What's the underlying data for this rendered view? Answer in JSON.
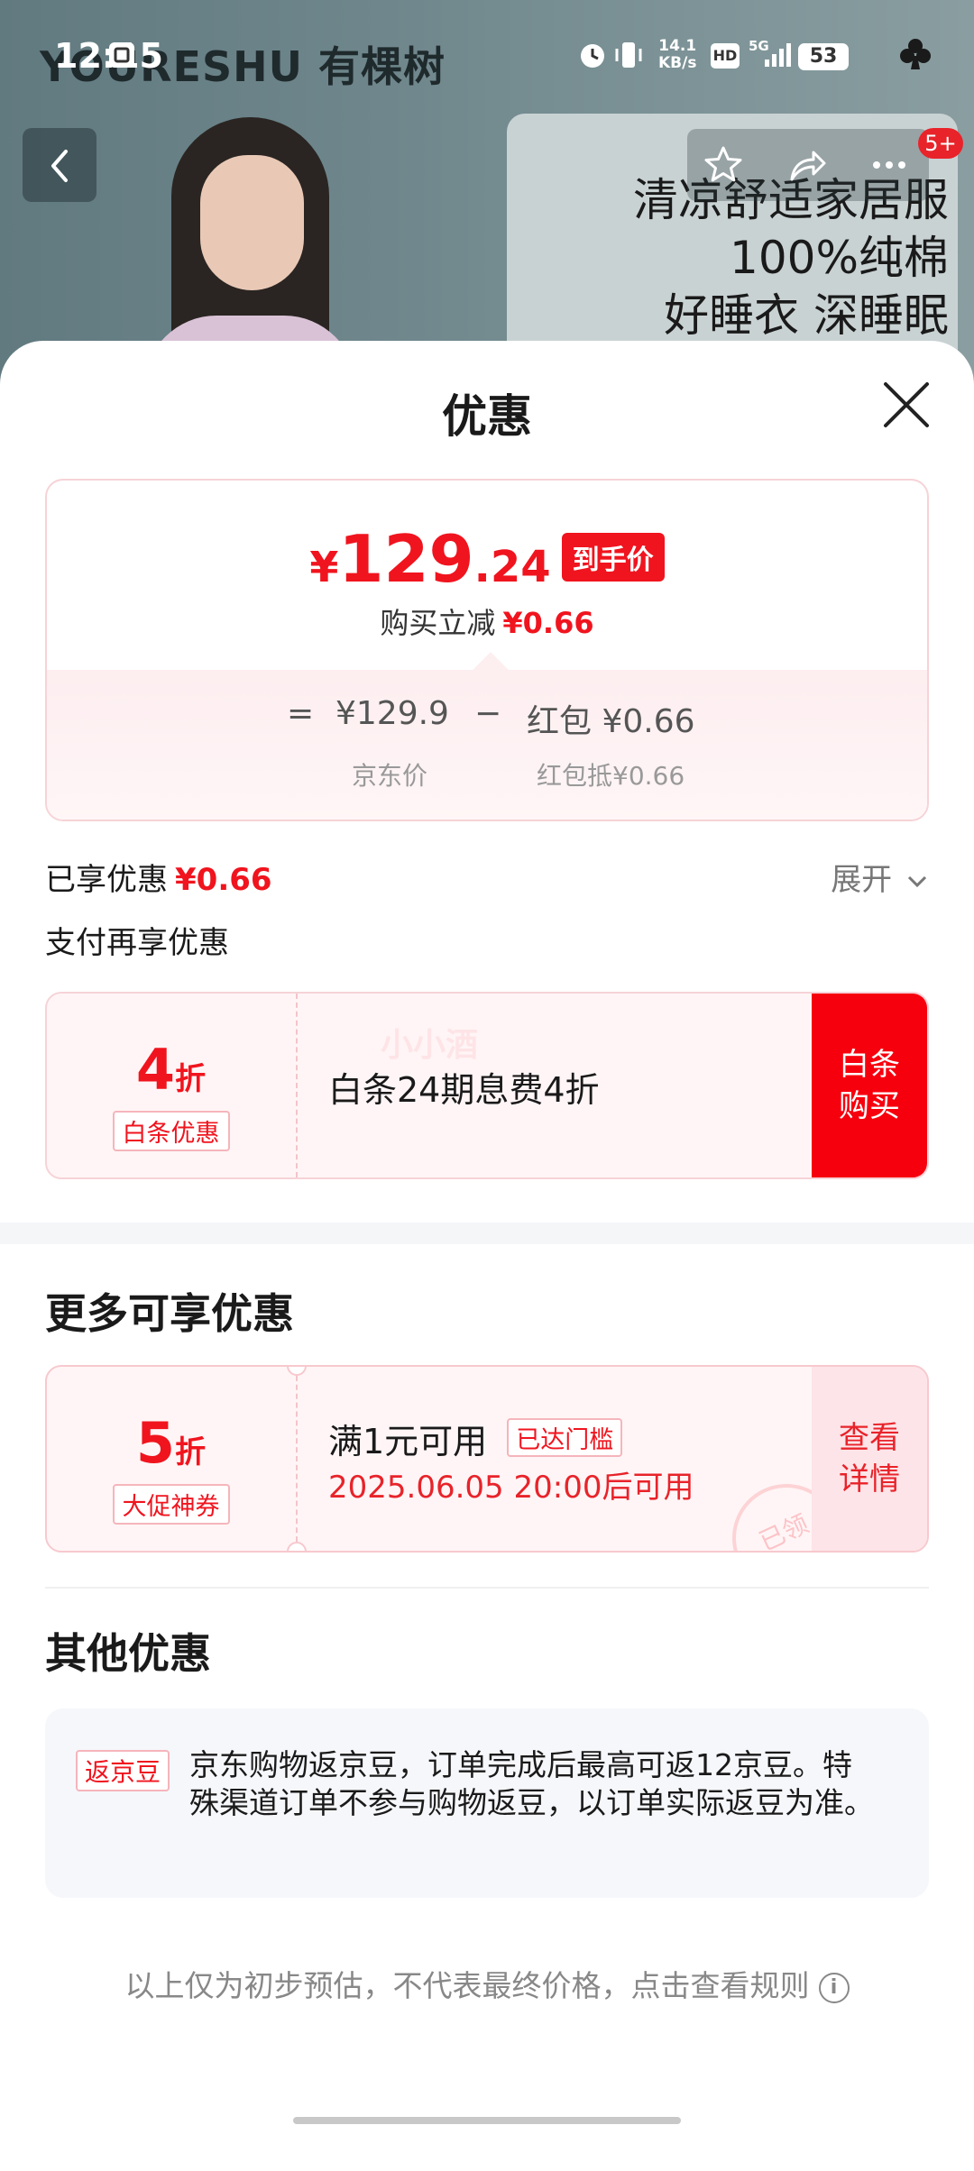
{
  "status_bar": {
    "time": "12:15",
    "net_speed_value": "14.1",
    "net_speed_unit": "KB/s",
    "hd_label": "HD",
    "network_label": "5G",
    "battery_level": "53"
  },
  "background": {
    "brand": "YOURESHU 有棵树",
    "slogan_lines": [
      "清凉舒适家居服",
      "100%纯棉",
      "好睡衣 深睡眠"
    ],
    "message_badge": "5+"
  },
  "sheet": {
    "title": "优惠",
    "price": {
      "currency": "¥",
      "integer": "129",
      "decimal": ".24",
      "tag": "到手价",
      "instant_reduce_label": "购买立减",
      "instant_reduce_value": "¥0.66",
      "formula_eq": "=",
      "jd_price": "¥129.9",
      "minus": "−",
      "redpacket": "红包 ¥0.66",
      "jd_price_caption": "京东价",
      "redpacket_caption": "红包抵¥0.66"
    },
    "enjoyed_label": "已享优惠",
    "enjoyed_value": "¥0.66",
    "expand_label": "展开",
    "pay_more_label": "支付再享优惠",
    "baitiao": {
      "discount_num": "4",
      "discount_unit": "折",
      "kind": "白条优惠",
      "text": "白条24期息费4折",
      "action": "白条\n购买",
      "watermark": "小小酒"
    },
    "more_heading": "更多可享优惠",
    "promo": {
      "discount_num": "5",
      "discount_unit": "折",
      "kind": "大促神券",
      "line1": "满1元可用",
      "threshold_tag": "已达门槛",
      "line2": "2025.06.05 20:00后可用",
      "action": "查看\n详情",
      "stamp": "已领"
    },
    "other_heading": "其他优惠",
    "bean": {
      "tag": "返京豆",
      "text": "京东购物返京豆，订单完成后最高可返12京豆。特殊渠道订单不参与购物返豆，以订单实际返豆为准。"
    },
    "footnote": "以上仅为初步预估，不代表最终价格，点击查看规则",
    "info_icon": "i"
  },
  "colors": {
    "accent": "#f0141e",
    "card_border": "#f6d3d7",
    "card_bg": "#fff5f6"
  }
}
